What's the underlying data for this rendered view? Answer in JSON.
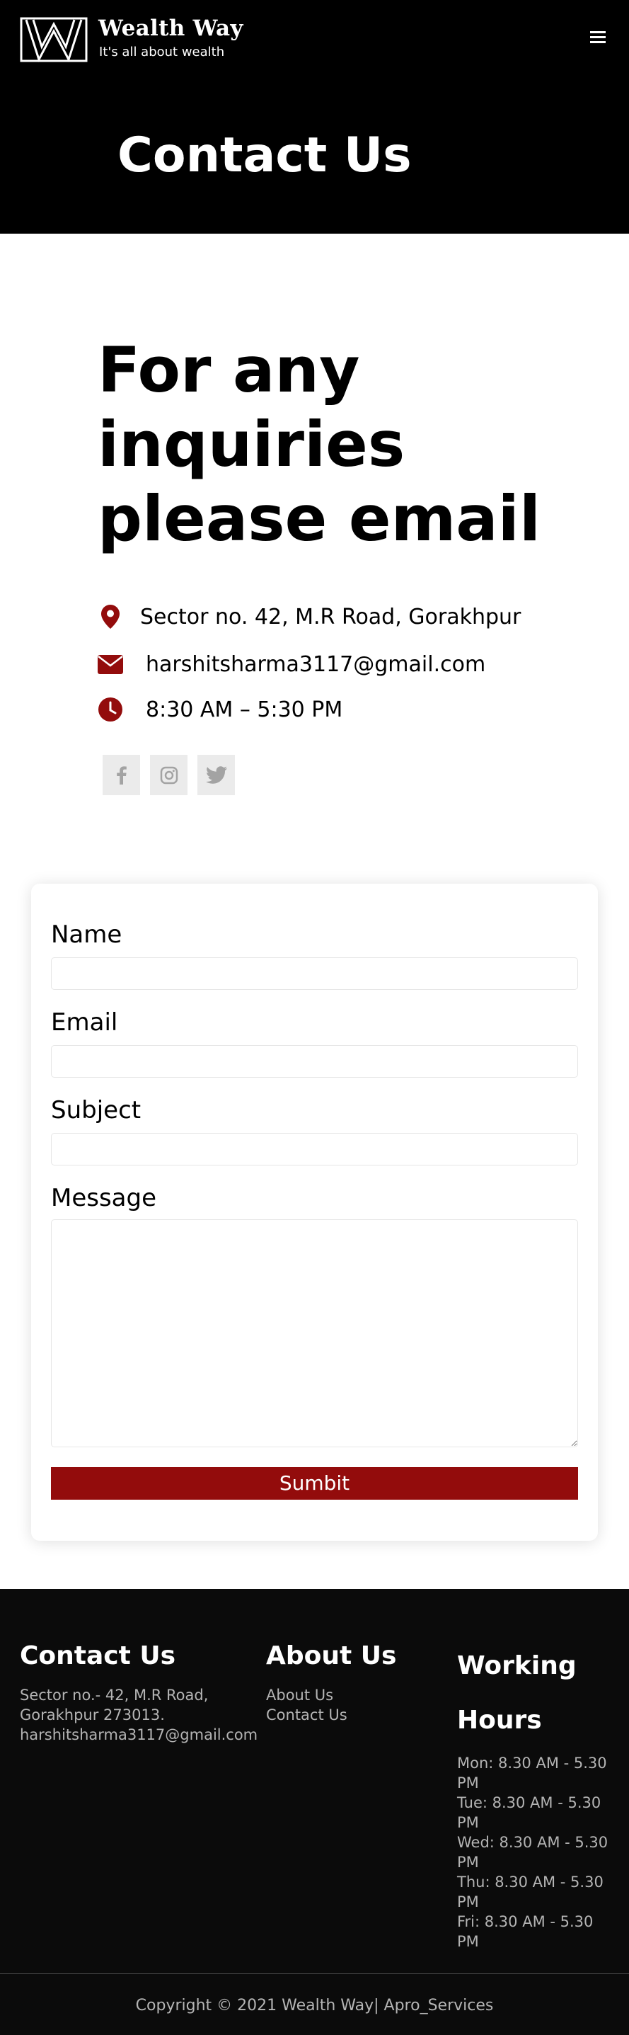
{
  "brand": {
    "name": "Wealth Way",
    "tagline": "It's all about wealth"
  },
  "header": {
    "menu_icon": "hamburger-icon",
    "page_title": "Contact Us"
  },
  "main": {
    "headline": "For any inquiries please email",
    "address": "Sector no. 42, M.R Road, Gorakhpur",
    "email": "harshitsharma3117@gmail.com",
    "hours": "8:30 AM – 5:30 PM",
    "icons": {
      "address": "map-marker-icon",
      "email": "envelope-icon",
      "hours": "clock-icon"
    },
    "socials": [
      "facebook-icon",
      "instagram-icon",
      "twitter-icon"
    ]
  },
  "form": {
    "name_label": "Name",
    "email_label": "Email",
    "subject_label": "Subject",
    "message_label": "Message",
    "submit_label": "Sumbit"
  },
  "footer": {
    "contact_heading": "Contact Us",
    "contact_lines": [
      "Sector no.- 42, M.R Road,",
      "Gorakhpur 273013.",
      "harshitsharma3117@gmail.com"
    ],
    "about_heading": "About Us",
    "about_links": [
      "About Us",
      "Contact Us"
    ],
    "hours_heading_line1": "Working",
    "hours_heading_line2": "Hours",
    "hours_lines": [
      "Mon: 8.30 AM - 5.30",
      "PM",
      "Tue: 8.30 AM - 5.30",
      "PM",
      "Wed: 8.30 AM - 5.30",
      "PM",
      "Thu: 8.30 AM - 5.30",
      "PM",
      "Fri: 8.30 AM - 5.30",
      "PM"
    ],
    "copyright": "Copyright © 2021 Wealth Way| Apro_Services"
  },
  "colors": {
    "header_bg": "#000000",
    "accent": "#930c0c",
    "footer_bg": "#0b0b0b",
    "footer_text": "#b4b4b4",
    "social_bg": "#ebebeb"
  }
}
